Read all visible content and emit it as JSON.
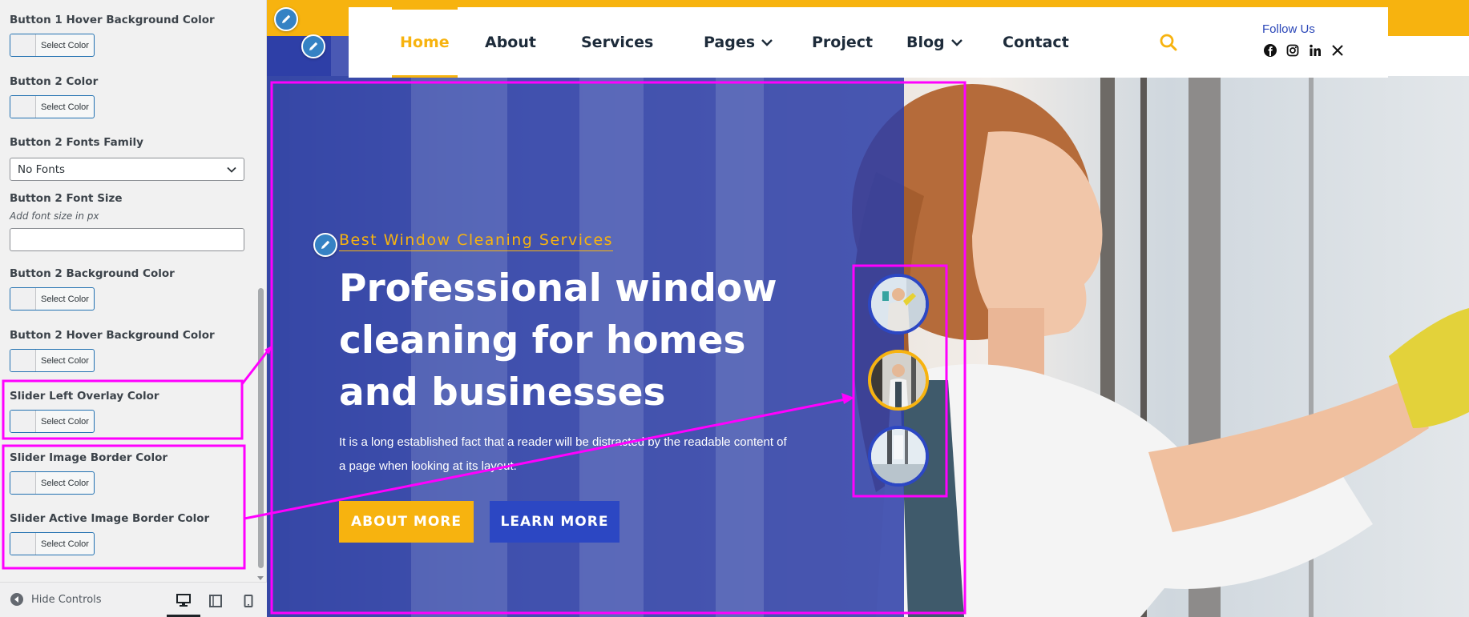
{
  "sidebar": {
    "controls": [
      {
        "label": "Button 1 Hover Background Color",
        "type": "color"
      },
      {
        "label": "Button 2 Color",
        "type": "color"
      },
      {
        "label": "Button 2 Fonts Family",
        "type": "select",
        "value": "No Fonts"
      },
      {
        "label": "Button 2 Font Size",
        "type": "text",
        "description": "Add font size in px"
      },
      {
        "label": "Button 2 Background Color",
        "type": "color"
      },
      {
        "label": "Button 2 Hover Background Color",
        "type": "color"
      },
      {
        "label": "Slider Left Overlay Color",
        "type": "color"
      },
      {
        "label": "Slider Image Border Color",
        "type": "color"
      },
      {
        "label": "Slider Active Image Border Color",
        "type": "color"
      }
    ],
    "select_color_label": "Select Color",
    "footer": {
      "hide_controls": "Hide Controls"
    }
  },
  "nav": {
    "items": [
      {
        "label": "Home",
        "active": true
      },
      {
        "label": "About"
      },
      {
        "label": "Services"
      },
      {
        "label": "Pages",
        "dropdown": true
      },
      {
        "label": "Project"
      },
      {
        "label": "Blog",
        "dropdown": true
      },
      {
        "label": "Contact"
      }
    ],
    "follow_us": "Follow Us",
    "socials": [
      "facebook-icon",
      "instagram-icon",
      "linkedin-icon",
      "x-icon"
    ]
  },
  "hero": {
    "subtitle": "Best Window Cleaning Services",
    "headline": "Professional window cleaning for homes and businesses",
    "paragraph": "It is a long established fact that a reader will be distracted by the readable content of a page when looking at its layout.",
    "button_primary": "ABOUT MORE",
    "button_secondary": "LEARN MORE"
  },
  "colors": {
    "accent": "#f7b30f",
    "overlay": "#2c3ea8",
    "annotation": "#ff00ff",
    "button_blue": "#2c47c3"
  }
}
